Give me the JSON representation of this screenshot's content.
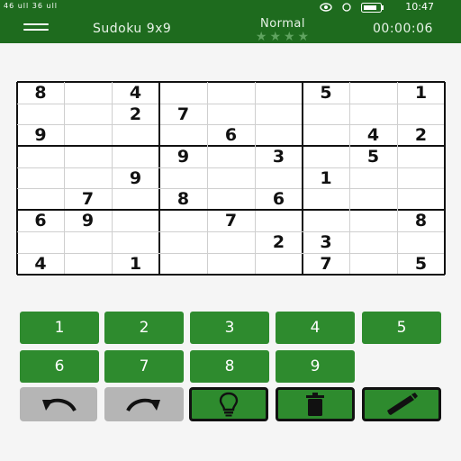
{
  "status": {
    "left_text": "46 ull 36 ull",
    "time": "10:47"
  },
  "header": {
    "title": "Sudoku 9x9",
    "difficulty": "Normal",
    "stars": "★★★★",
    "timer": "00:00:06"
  },
  "board": {
    "rows": [
      [
        "8",
        "",
        "4",
        "",
        "",
        "",
        "5",
        "",
        "1"
      ],
      [
        "",
        "",
        "2",
        "7",
        "",
        "",
        "",
        "",
        ""
      ],
      [
        "9",
        "",
        "",
        "",
        "6",
        "",
        "",
        "4",
        "2"
      ],
      [
        "",
        "",
        "",
        "9",
        "",
        "3",
        "",
        "5",
        ""
      ],
      [
        "",
        "",
        "9",
        "",
        "",
        "",
        "1",
        "",
        ""
      ],
      [
        "",
        "7",
        "",
        "8",
        "",
        "6",
        "",
        "",
        ""
      ],
      [
        "6",
        "9",
        "",
        "",
        "7",
        "",
        "",
        "",
        "8"
      ],
      [
        "",
        "",
        "",
        "",
        "",
        "2",
        "3",
        "",
        ""
      ],
      [
        "4",
        "",
        "1",
        "",
        "",
        "",
        "7",
        "",
        "5"
      ]
    ]
  },
  "keypad": {
    "keys": [
      "1",
      "2",
      "3",
      "4",
      "5",
      "6",
      "7",
      "8",
      "9"
    ]
  },
  "toolbar": {
    "undo_icon": "undo-arrow-icon",
    "redo_icon": "redo-arrow-icon",
    "hint_icon": "lightbulb-icon",
    "erase_icon": "trash-icon",
    "pencil_icon": "pencil-icon"
  },
  "colors": {
    "appbar": "#1e6b1e",
    "key": "#2e8b2e",
    "tool_gray": "#b5b5b5"
  }
}
